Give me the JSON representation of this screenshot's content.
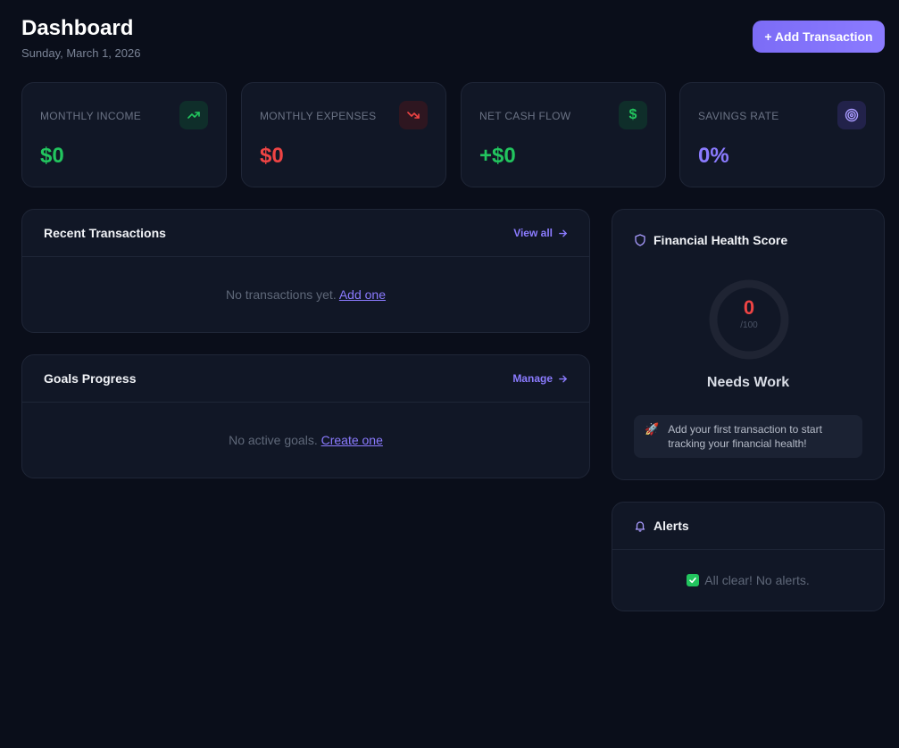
{
  "header": {
    "title": "Dashboard",
    "date": "Sunday, March 1, 2026",
    "add_button": "+ Add Transaction"
  },
  "stats": [
    {
      "label": "MONTHLY INCOME",
      "value": "$0",
      "icon": "trending-up-icon",
      "color": "#22c55e"
    },
    {
      "label": "MONTHLY EXPENSES",
      "value": "$0",
      "icon": "trending-down-icon",
      "color": "#ef4444"
    },
    {
      "label": "NET CASH FLOW",
      "value": "+$0",
      "icon": "dollar-icon",
      "color": "#22c55e"
    },
    {
      "label": "SAVINGS RATE",
      "value": "0%",
      "icon": "target-icon",
      "color": "#8b7bff"
    }
  ],
  "transactions": {
    "title": "Recent Transactions",
    "link": "View all",
    "empty_text": "No transactions yet.",
    "empty_link": "Add one"
  },
  "goals": {
    "title": "Goals Progress",
    "link": "Manage",
    "empty_text": "No active goals.",
    "empty_link": "Create one"
  },
  "health": {
    "title": "Financial Health Score",
    "score": "0",
    "max": "/100",
    "score_fraction": 0,
    "status": "Needs Work",
    "tip": "Add your first transaction to start tracking your financial health!"
  },
  "alerts": {
    "title": "Alerts",
    "empty_text": "All clear! No alerts."
  },
  "colors": {
    "accent": "#8b7bff",
    "positive": "#22c55e",
    "negative": "#ef4444",
    "background": "#0a0e1a",
    "card": "#111726"
  }
}
